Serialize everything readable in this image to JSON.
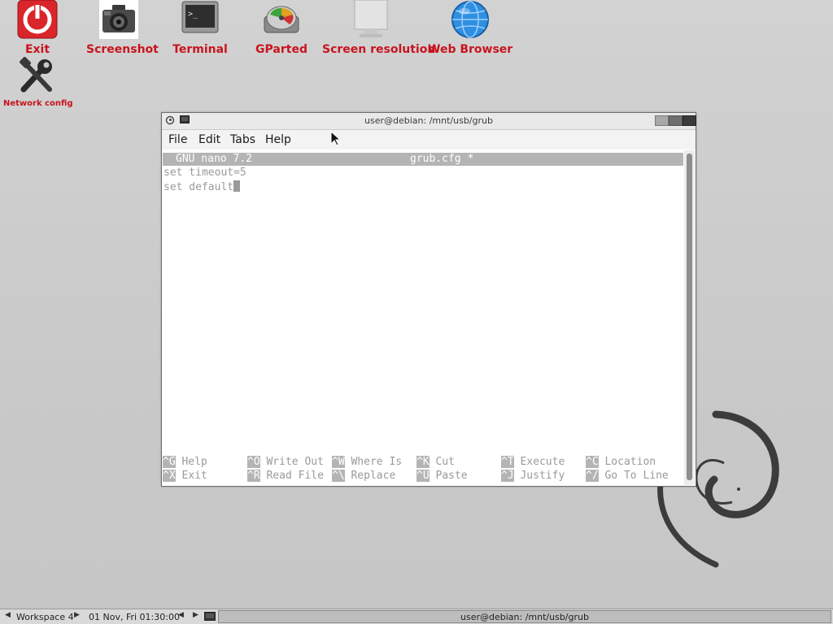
{
  "desktop": {
    "icons": [
      {
        "label": "Exit"
      },
      {
        "label": "Screenshot"
      },
      {
        "label": "Terminal"
      },
      {
        "label": "GParted"
      },
      {
        "label": "Screen resolution"
      },
      {
        "label": "Web Browser"
      },
      {
        "label": "Network config"
      }
    ]
  },
  "window": {
    "title": "user@debian: /mnt/usb/grub",
    "menu": [
      "File",
      "Edit",
      "Tabs",
      "Help"
    ]
  },
  "nano": {
    "version": "GNU nano 7.2",
    "filename": "grub.cfg *",
    "lines": [
      "set timeout=5",
      "set default"
    ],
    "shortcuts_row1": [
      {
        "key": "^G",
        "label": "Help"
      },
      {
        "key": "^O",
        "label": "Write Out"
      },
      {
        "key": "^W",
        "label": "Where Is"
      },
      {
        "key": "^K",
        "label": "Cut"
      },
      {
        "key": "^T",
        "label": "Execute"
      },
      {
        "key": "^C",
        "label": "Location"
      }
    ],
    "shortcuts_row2": [
      {
        "key": "^X",
        "label": "Exit"
      },
      {
        "key": "^R",
        "label": "Read File"
      },
      {
        "key": "^\\",
        "label": "Replace"
      },
      {
        "key": "^U",
        "label": "Paste"
      },
      {
        "key": "^J",
        "label": "Justify"
      },
      {
        "key": "^/",
        "label": "Go To Line"
      }
    ]
  },
  "taskbar": {
    "workspace": "Workspace 4",
    "clock": "01 Nov, Fri 01:30:00",
    "task": "user@debian: /mnt/usb/grub"
  },
  "colors": {
    "icon_label": "#c8141e",
    "nano_bar": "#b4b4b4",
    "text_dim": "#9a9a9a"
  }
}
